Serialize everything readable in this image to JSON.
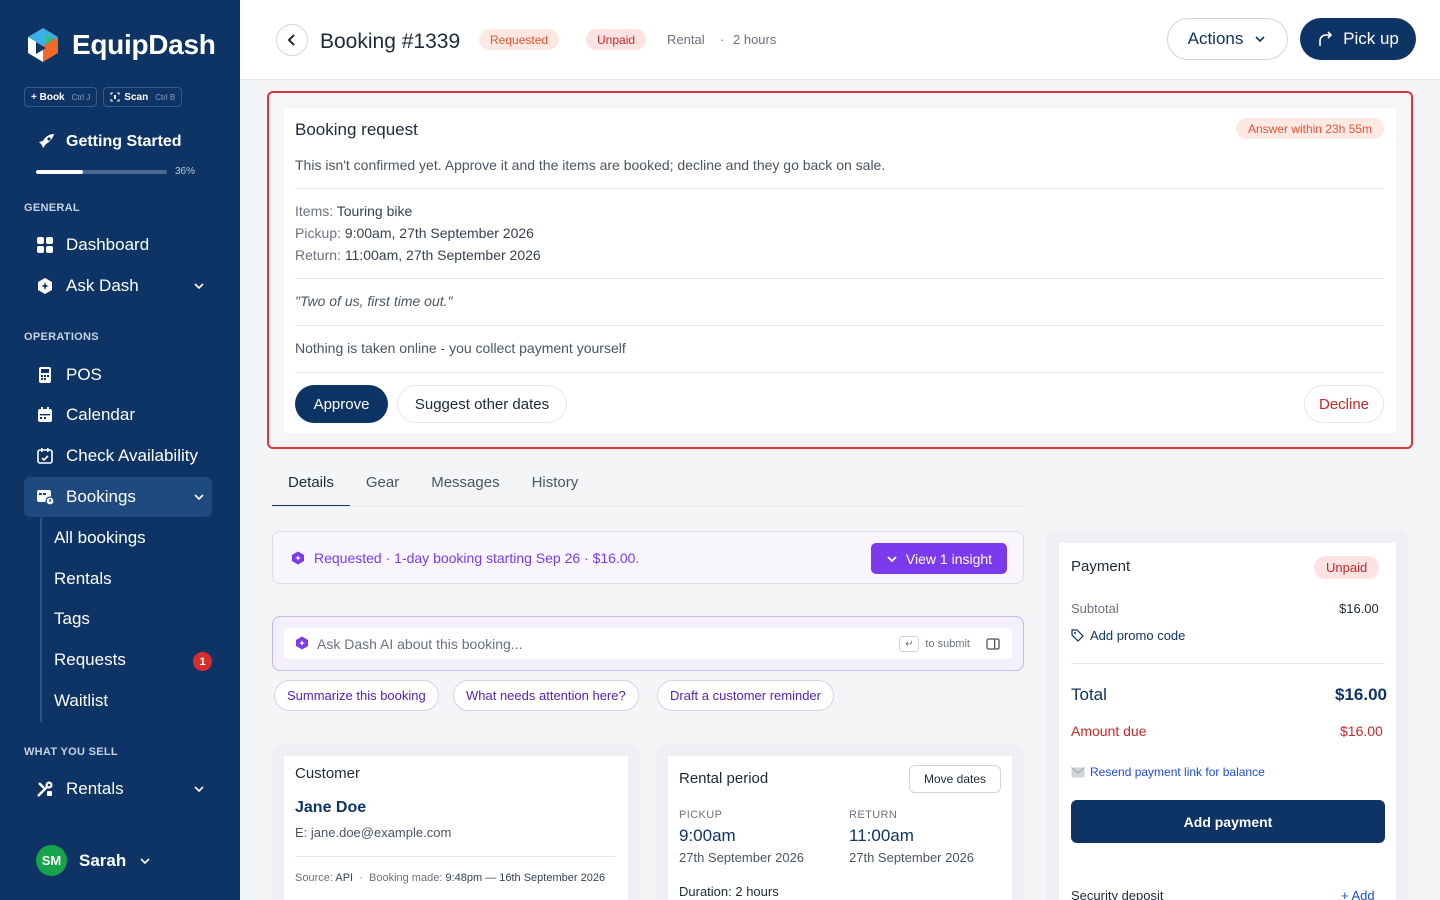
{
  "app": {
    "name": "EquipDash"
  },
  "quick": {
    "book": {
      "label": "+ Book",
      "shortcut": "Ctrl J"
    },
    "scan": {
      "label": "Scan",
      "shortcut": "Ctrl B"
    }
  },
  "getting_started": {
    "label": "Getting Started",
    "progress_percent": 36,
    "progress_text": "36%"
  },
  "nav": {
    "general_label": "GENERAL",
    "dashboard": "Dashboard",
    "ask_dash": "Ask Dash",
    "operations_label": "OPERATIONS",
    "pos": "POS",
    "calendar": "Calendar",
    "check_availability": "Check Availability",
    "bookings": "Bookings",
    "sub": {
      "all_bookings": "All bookings",
      "rentals": "Rentals",
      "tags": "Tags",
      "requests": "Requests",
      "requests_count": "1",
      "waitlist": "Waitlist"
    },
    "what_you_sell_label": "WHAT YOU SELL",
    "rentals": "Rentals"
  },
  "user": {
    "initials": "SM",
    "name": "Sarah"
  },
  "header": {
    "title": "Booking #1339",
    "status": "Requested",
    "payment_status": "Unpaid",
    "type": "Rental",
    "separator": "·",
    "duration": "2 hours",
    "actions_label": "Actions",
    "pickup_label": "Pick up"
  },
  "request": {
    "title": "Booking request",
    "answer_within": "Answer within 23h 55m",
    "intro": "This isn't confirmed yet. Approve it and the items are booked; decline and they go back on sale.",
    "items_label": "Items:",
    "items_value": "Touring bike",
    "pickup_label": "Pickup:",
    "pickup_value": "9:00am, 27th September 2026",
    "return_label": "Return:",
    "return_value": "11:00am, 27th September 2026",
    "note": "\"Two of us, first time out.\"",
    "payment_note": "Nothing is taken online - you collect payment yourself",
    "approve_label": "Approve",
    "suggest_label": "Suggest other dates",
    "decline_label": "Decline"
  },
  "tabs": [
    "Details",
    "Gear",
    "Messages",
    "History"
  ],
  "insight": {
    "text": "Requested · 1-day booking starting Sep 26 · $16.00.",
    "button": "View 1 insight"
  },
  "ask": {
    "placeholder": "Ask Dash AI about this booking...",
    "hint_key": "↵",
    "hint_text": "to submit"
  },
  "chips": [
    "Summarize this booking",
    "What needs attention here?",
    "Draft a customer reminder"
  ],
  "customer": {
    "title": "Customer",
    "name": "Jane Doe",
    "email": "E: jane.doe@example.com",
    "source_label": "Source:",
    "source_value": "API",
    "made_label": "Booking made:",
    "made_value": "9:48pm — 16th September 2026"
  },
  "rental_period": {
    "title": "Rental period",
    "move_label": "Move dates",
    "pickup_label": "PICKUP",
    "pickup_time": "9:00am",
    "pickup_date": "27th September 2026",
    "return_label": "RETURN",
    "return_time": "11:00am",
    "return_date": "27th September 2026",
    "duration": "Duration: 2 hours"
  },
  "payment": {
    "title": "Payment",
    "status": "Unpaid",
    "subtotal_label": "Subtotal",
    "subtotal_value": "$16.00",
    "promo_label": "Add promo code",
    "total_label": "Total",
    "total_value": "$16.00",
    "due_label": "Amount due",
    "due_value": "$16.00",
    "resend_label": "Resend payment link for balance",
    "add_payment_label": "Add payment",
    "deposit_label": "Security deposit",
    "deposit_add": "+ Add"
  },
  "colors": {
    "sidebar": "#0e3466",
    "accent": "#0e3466",
    "ai_purple": "#7c3aed",
    "danger": "#c62828",
    "warning": "#e2553a"
  }
}
